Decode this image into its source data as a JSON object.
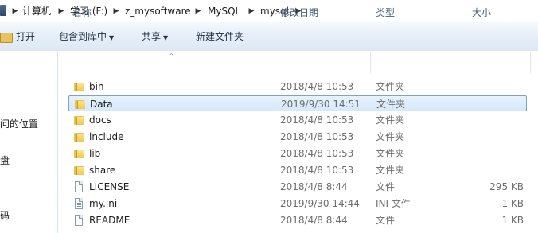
{
  "breadcrumb": {
    "items": [
      "计算机",
      "学习 (F:)",
      "z_mysoftware",
      "MySQL",
      "mysql"
    ],
    "separator": "▶"
  },
  "toolbar": {
    "open_label": "打开",
    "include_label": "包含到库中",
    "share_label": "共享",
    "new_folder_label": "新建文件夹",
    "dropdown_glyph": "▼"
  },
  "nav": {
    "items": [
      "问的位置",
      "盘",
      "码"
    ]
  },
  "columns": {
    "name": "名称",
    "modified": "修改日期",
    "type": "类型",
    "size": "大小",
    "sort_glyph": "^"
  },
  "files": [
    {
      "name": "bin",
      "date": "2018/4/8 10:53",
      "type": "文件夹",
      "size": "",
      "icon": "folder-icon"
    },
    {
      "name": "Data",
      "date": "2019/9/30 14:51",
      "type": "文件夹",
      "size": "",
      "icon": "folder-icon",
      "selected": true
    },
    {
      "name": "docs",
      "date": "2018/4/8 10:53",
      "type": "文件夹",
      "size": "",
      "icon": "folder-icon"
    },
    {
      "name": "include",
      "date": "2018/4/8 10:53",
      "type": "文件夹",
      "size": "",
      "icon": "folder-icon"
    },
    {
      "name": "lib",
      "date": "2018/4/8 10:53",
      "type": "文件夹",
      "size": "",
      "icon": "folder-icon"
    },
    {
      "name": "share",
      "date": "2018/4/8 10:53",
      "type": "文件夹",
      "size": "",
      "icon": "folder-icon"
    },
    {
      "name": "LICENSE",
      "date": "2018/4/8 8:44",
      "type": "文件",
      "size": "295 KB",
      "icon": "file-icon"
    },
    {
      "name": "my.ini",
      "date": "2019/9/30 14:44",
      "type": "INI 文件",
      "size": "1 KB",
      "icon": "ini-file-icon"
    },
    {
      "name": "README",
      "date": "2018/4/8 8:44",
      "type": "文件",
      "size": "1 KB",
      "icon": "file-icon"
    }
  ],
  "colors": {
    "selection_border": "#7da2ce",
    "selection_fill": "#d6e8fb",
    "folder": "#f0c94a"
  }
}
